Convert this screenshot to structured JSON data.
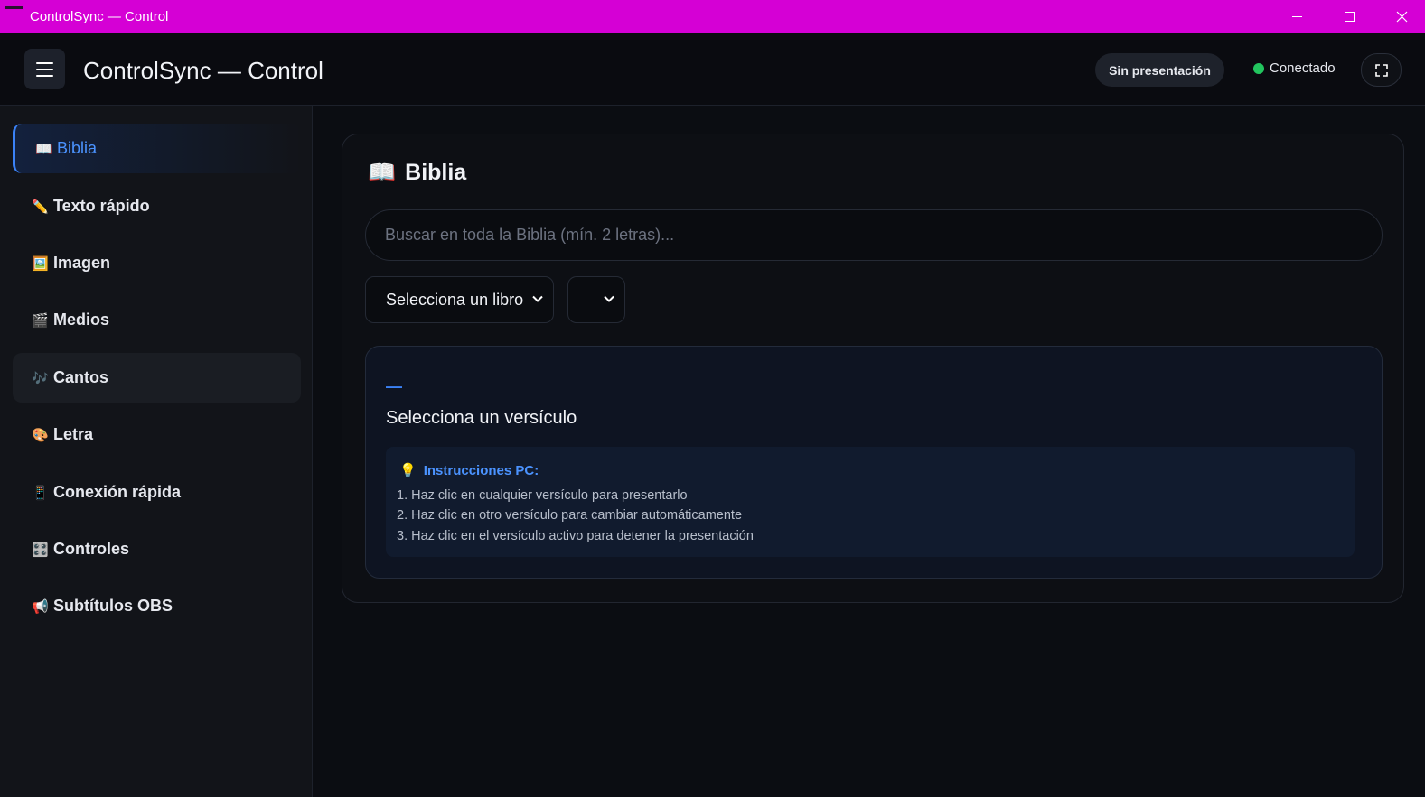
{
  "window": {
    "title": "ControlSync — Control"
  },
  "header": {
    "title": "ControlSync — Control",
    "presentation_status": "Sin presentación",
    "connection_status": "Conectado",
    "connection_color": "#22c55e"
  },
  "sidebar": {
    "items": [
      {
        "icon": "📖",
        "icon_name": "open-book-icon",
        "label": "Biblia",
        "active": true
      },
      {
        "icon": "✏️",
        "icon_name": "pencil-icon",
        "label": "Texto rápido"
      },
      {
        "icon": "🖼️",
        "icon_name": "picture-icon",
        "label": "Imagen"
      },
      {
        "icon": "🎬",
        "icon_name": "clapper-icon",
        "label": "Medios"
      },
      {
        "icon": "🎶",
        "icon_name": "music-notes-icon",
        "label": "Cantos",
        "hover": true
      },
      {
        "icon": "🎨",
        "icon_name": "palette-icon",
        "label": "Letra"
      },
      {
        "icon": "📱",
        "icon_name": "phone-icon",
        "label": "Conexión rápida"
      },
      {
        "icon": "🎛️",
        "icon_name": "control-knobs-icon",
        "label": "Controles"
      },
      {
        "icon": "📢",
        "icon_name": "megaphone-icon",
        "label": "Subtítulos OBS"
      }
    ]
  },
  "main": {
    "title_icon": "📖",
    "title": "Biblia",
    "search": {
      "placeholder": "Buscar en toda la Biblia (mín. 2 letras)...",
      "value": ""
    },
    "book_select": {
      "selected": "Selecciona un libro"
    },
    "chapter_select": {
      "selected": ""
    },
    "verse": {
      "reference": "—",
      "text": "Selecciona un versículo"
    },
    "instructions": {
      "icon": "💡",
      "title": "Instrucciones PC:",
      "lines": [
        "1. Haz clic en cualquier versículo para presentarlo",
        "2. Haz clic en otro versículo para cambiar automáticamente",
        "3. Haz clic en el versículo activo para detener la presentación"
      ]
    }
  },
  "colors": {
    "accent": "#3b82f6",
    "titlebar": "#d500d5",
    "background": "#0b0d12"
  }
}
